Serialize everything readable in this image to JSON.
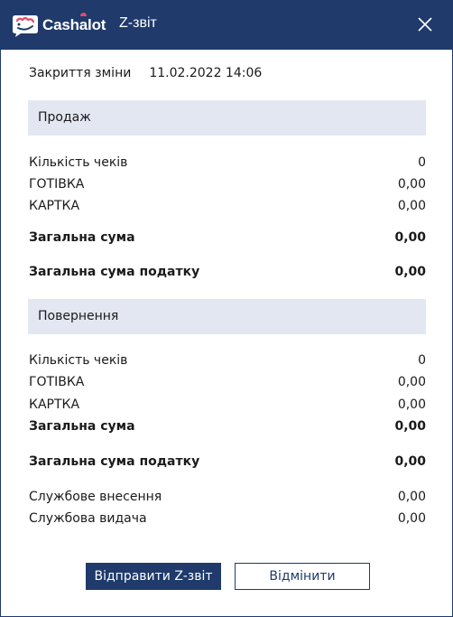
{
  "window": {
    "logo_text_before": "Cash",
    "logo_text_accent": "a",
    "logo_text_after": "lot",
    "title": "Z-звіт",
    "brand_color": "#1f3a6b",
    "logo_accent_color": "#e04b6b"
  },
  "shift": {
    "label": "Закриття зміни",
    "datetime": "11.02.2022 14:06"
  },
  "sales": {
    "header": "Продаж",
    "rows": [
      {
        "label": "Кількість чеків",
        "value": "0"
      },
      {
        "label": "ГОТІВКА",
        "value": "0,00"
      },
      {
        "label": "КАРТКА",
        "value": "0,00"
      }
    ],
    "total_label": "Загальна сума",
    "total_value": "0,00",
    "tax_label": "Загальна сума податку",
    "tax_value": "0,00"
  },
  "returns": {
    "header": "Повернення",
    "rows": [
      {
        "label": "Кількість чеків",
        "value": "0"
      },
      {
        "label": "ГОТІВКА",
        "value": "0,00"
      },
      {
        "label": "КАРТКА",
        "value": "0,00"
      }
    ],
    "total_label": "Загальна сума",
    "total_value": "0,00",
    "tax_label": "Загальна сума податку",
    "tax_value": "0,00"
  },
  "service": {
    "deposit_label": "Службове внесення",
    "deposit_value": "0,00",
    "withdrawal_label": "Службова видача",
    "withdrawal_value": "0,00"
  },
  "actions": {
    "send_label": "Відправити Z-звіт",
    "cancel_label": "Відмінити"
  },
  "icons": {
    "logo": "cashalot-logo-icon",
    "close": "close-icon"
  }
}
